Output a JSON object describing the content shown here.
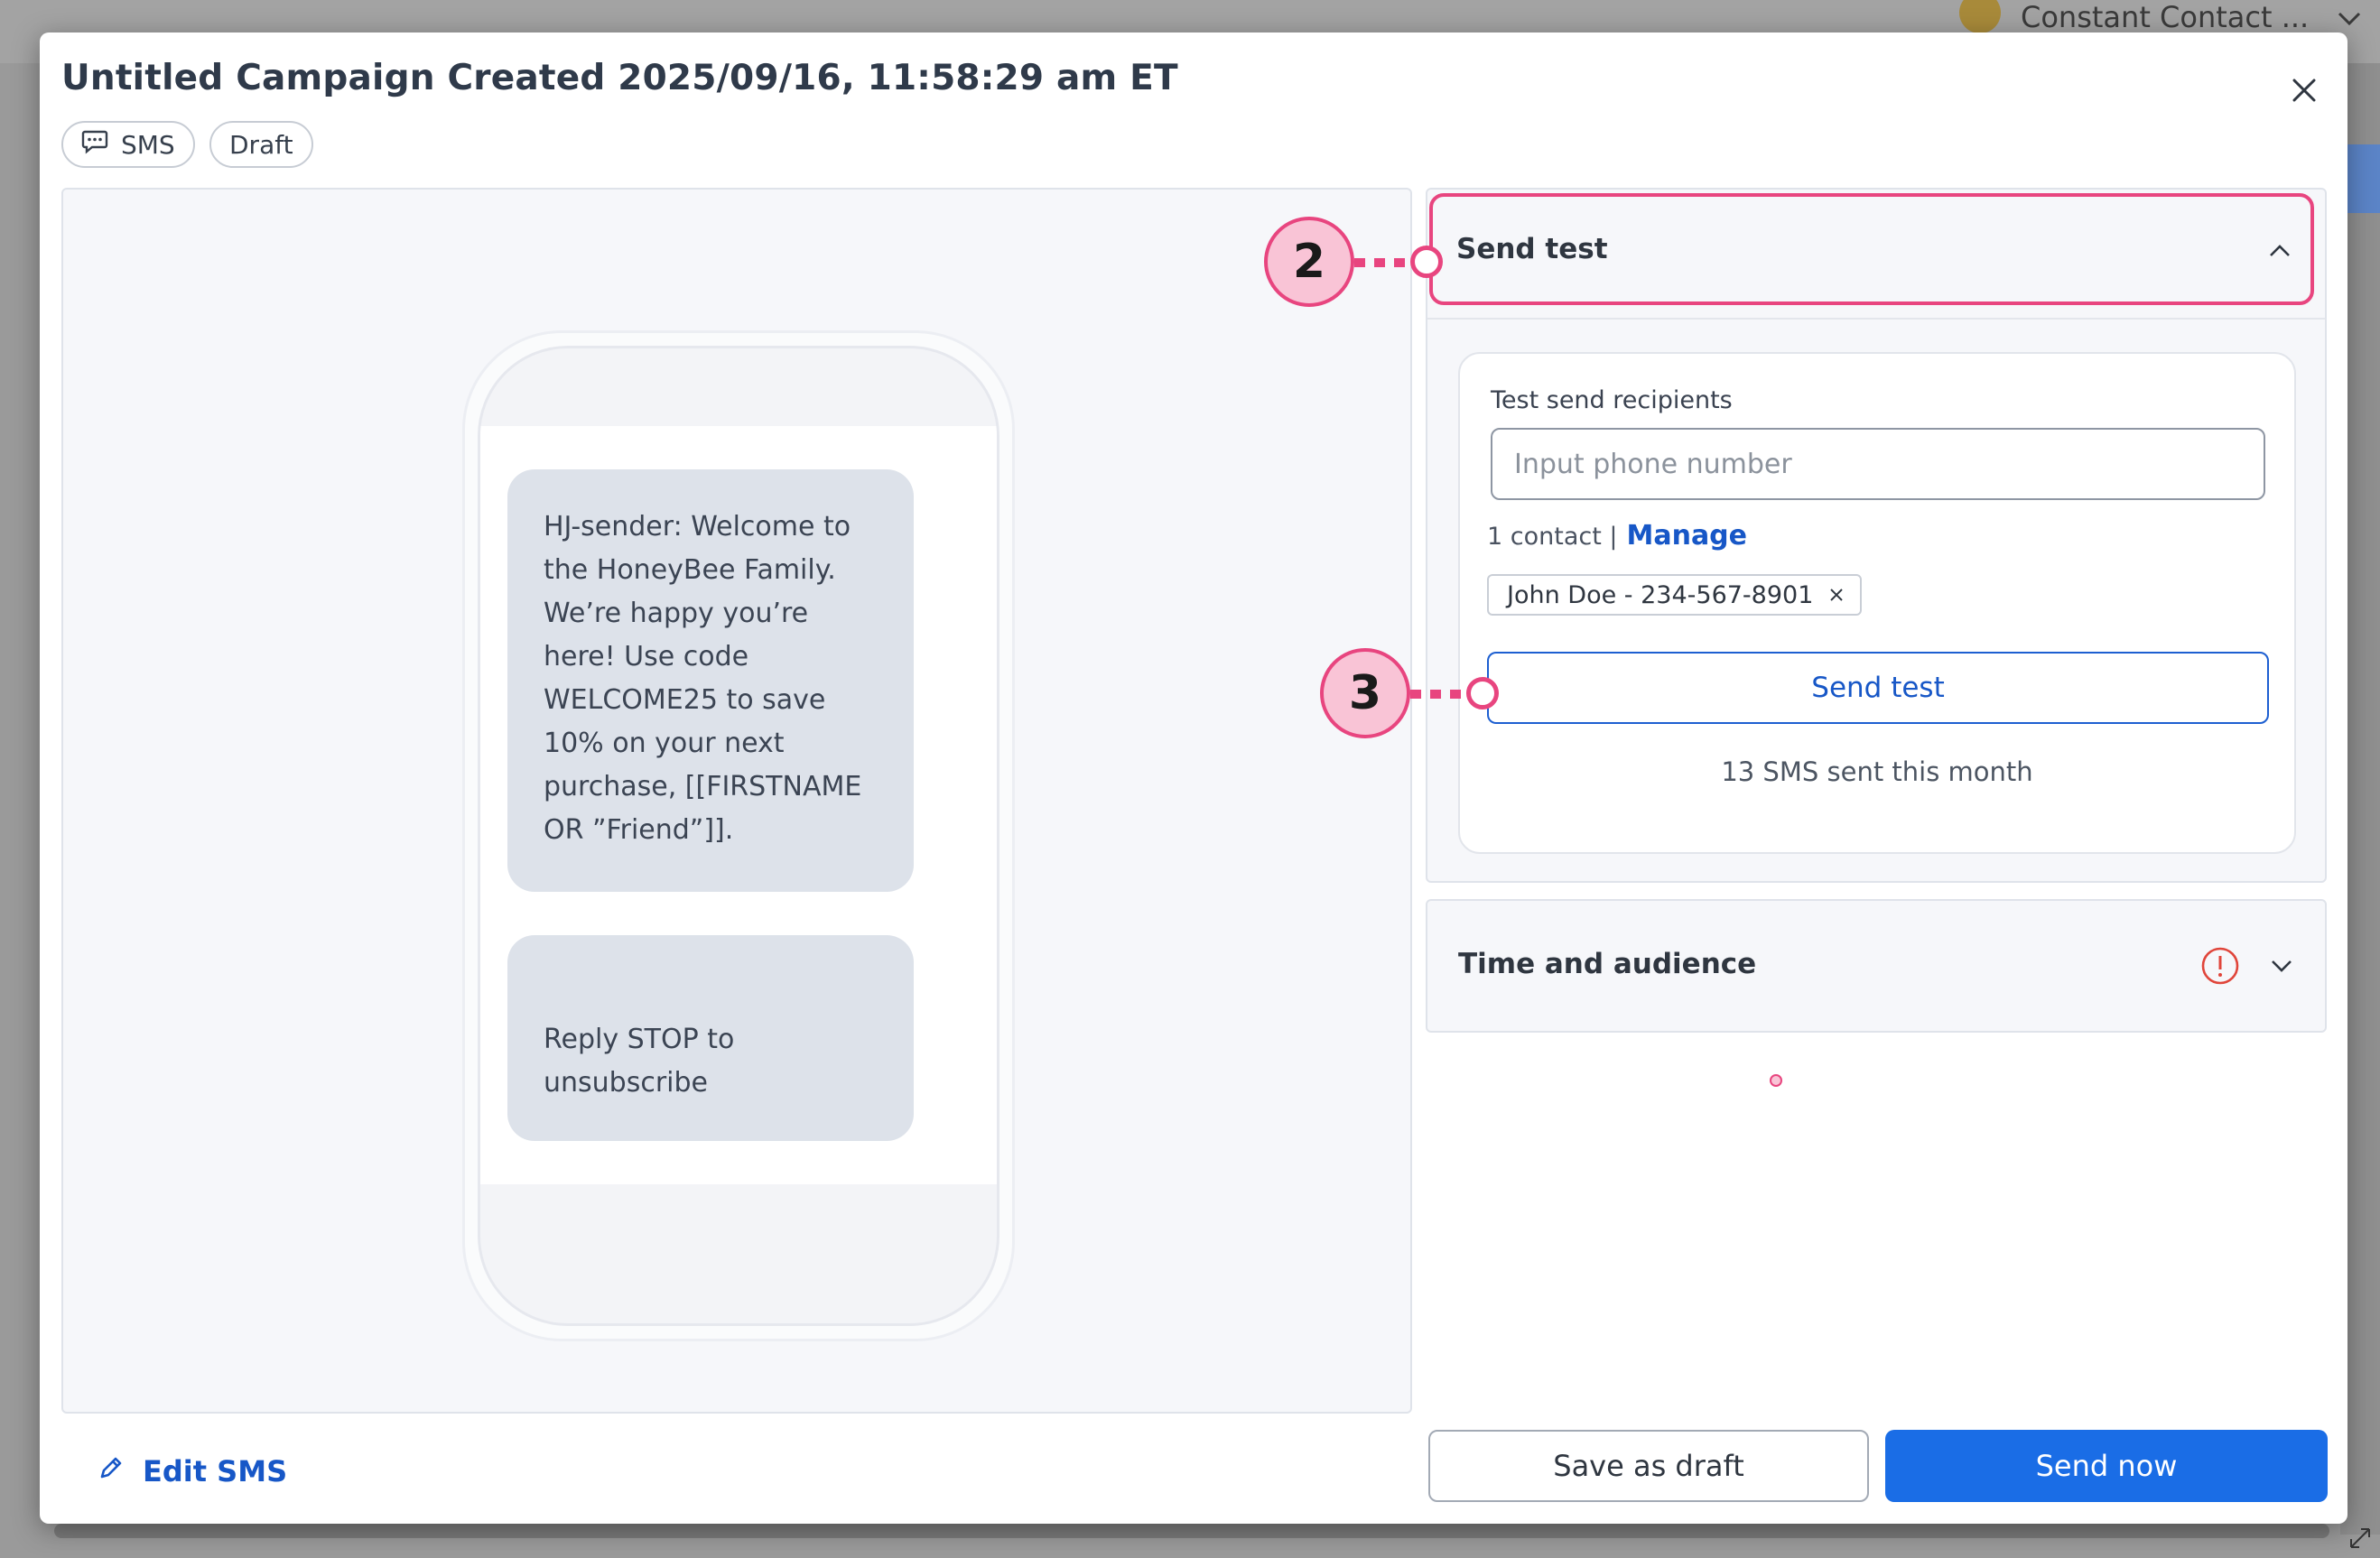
{
  "background_app": {
    "account_name": "Constant Contact ...",
    "icons": [
      "avatar",
      "chevron-down-icon",
      "resize-icon"
    ]
  },
  "modal": {
    "title": "Untitled Campaign Created 2025/09/16, 11:58:29 am ET",
    "chips": {
      "sms": "SMS",
      "draft": "Draft"
    },
    "icons": [
      "close-icon",
      "chat-bubble-icon"
    ]
  },
  "preview": {
    "messages": [
      "HJ-sender: Welcome to the HoneyBee Family. We’re happy you’re here! Use code WELCOME25 to save 10% on your next purchase, [[FIRSTNAME OR ”Friend”]].",
      "Reply STOP to unsubscribe"
    ]
  },
  "send_test": {
    "title": "Send test",
    "recipients_label": "Test send recipients",
    "phone_placeholder": "Input phone number",
    "phone_value": "",
    "contact_count": "1 contact |",
    "manage_label": "Manage",
    "recipient": "John Doe - 234-567-8901",
    "button_label": "Send test",
    "usage": "13 SMS sent this month",
    "icons": [
      "chevron-up-icon",
      "remove-x-icon"
    ]
  },
  "time_audience": {
    "title": "Time and audience",
    "icons": [
      "warning-icon",
      "chevron-down-icon"
    ],
    "status_color": "#e0453a"
  },
  "annotations": {
    "step_2": "2",
    "step_3": "3",
    "color": "#e8457f"
  },
  "footer": {
    "edit_label": "Edit SMS",
    "save_draft_label": "Save as draft",
    "send_now_label": "Send now",
    "icons": [
      "pencil-icon"
    ],
    "primary_color": "#1a6de6"
  }
}
